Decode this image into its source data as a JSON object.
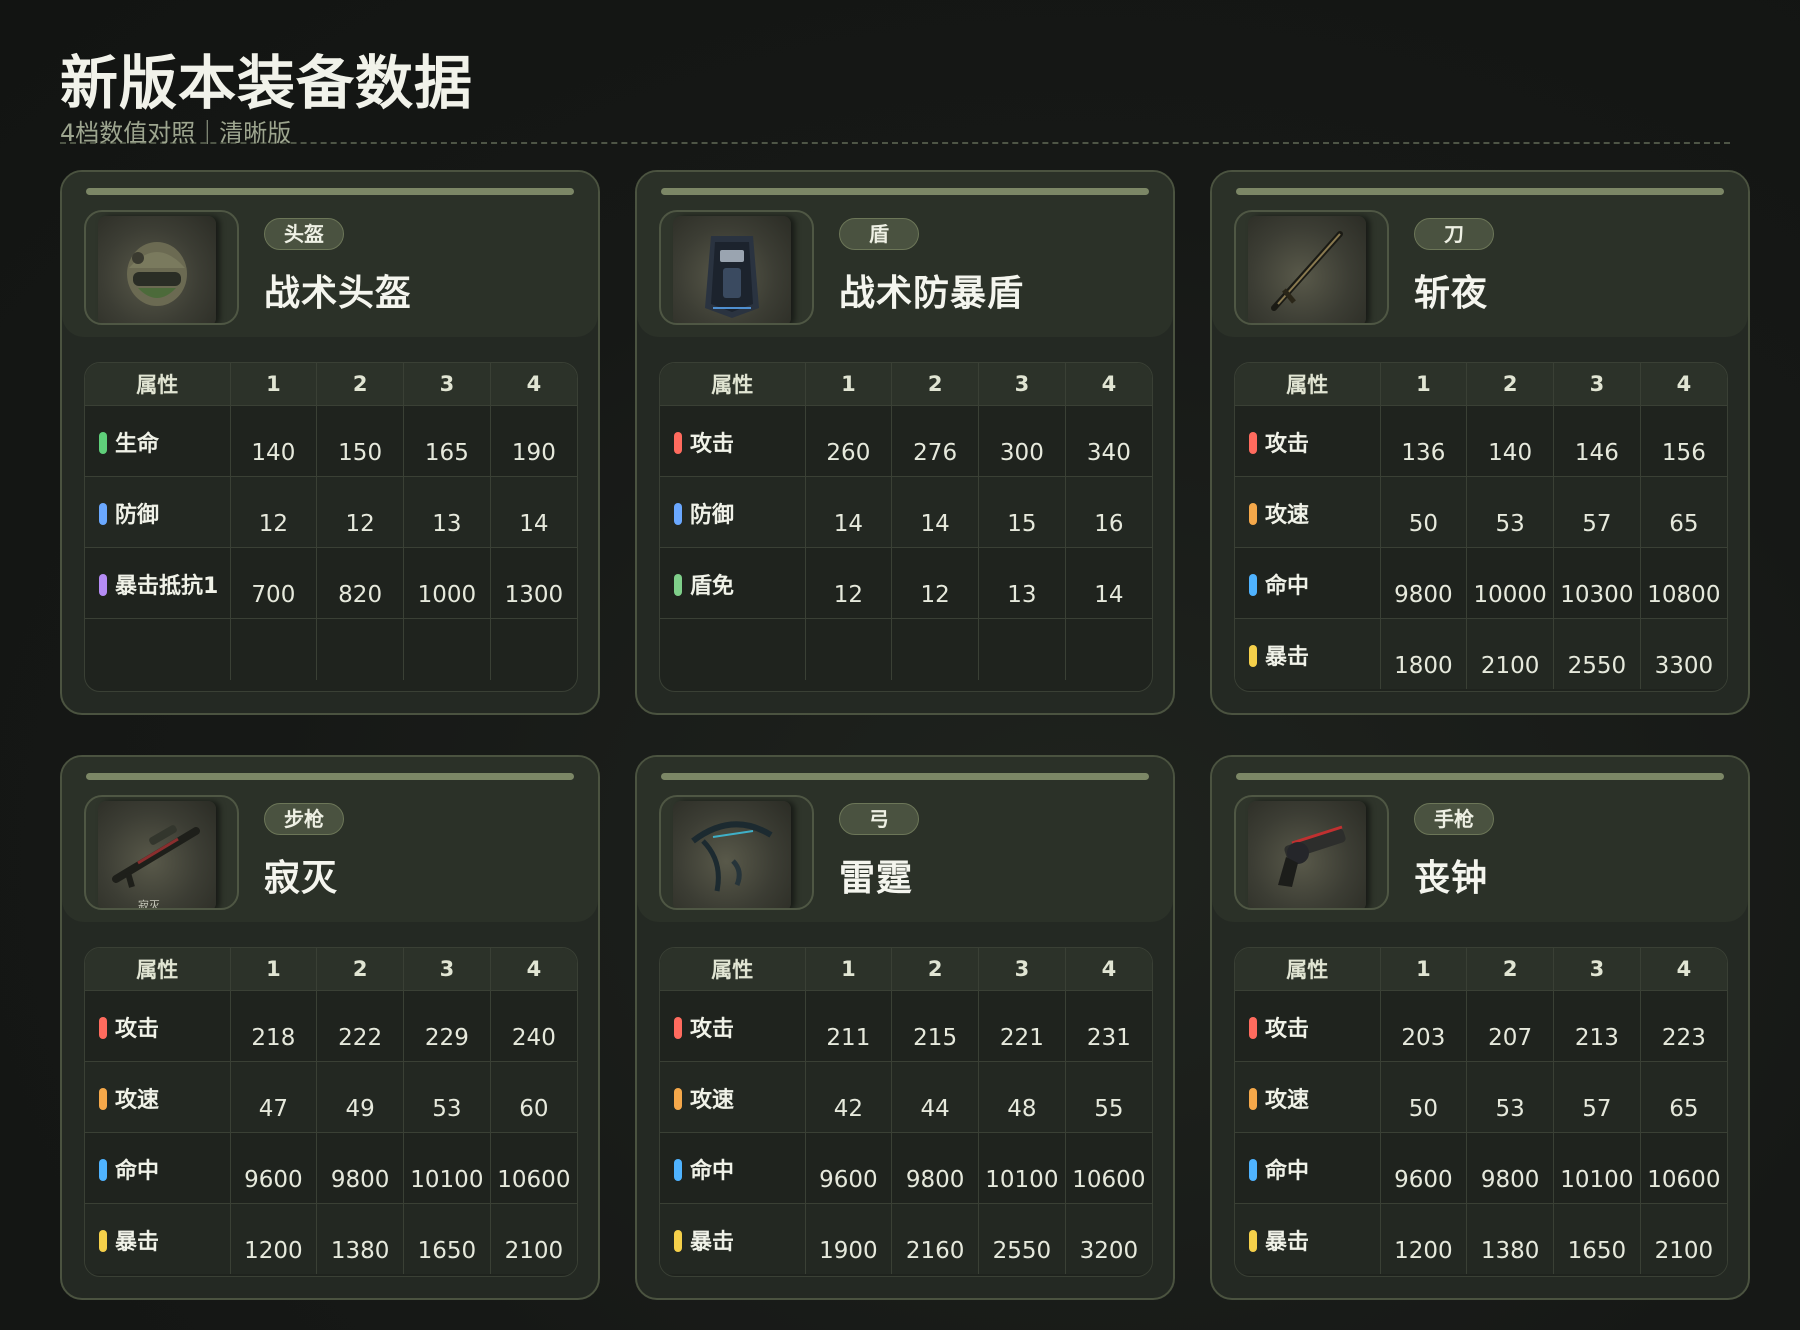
{
  "header": {
    "title": "新版本装备数据",
    "subtitle": "4档数值对照｜清晰版"
  },
  "table_headers": [
    "属性",
    "1",
    "2",
    "3",
    "4"
  ],
  "colors": {
    "hp": "#5fcf7a",
    "def": "#6aa8ff",
    "crit_res": "#b58cf5",
    "atk": "#ff6b5e",
    "spd": "#f5a84a",
    "hit": "#4fb3ff",
    "crit": "#f5d04a",
    "block": "#7fcf8a"
  },
  "cards": [
    {
      "tag": "头盔",
      "name": "战术头盔",
      "icon": "helmet-icon",
      "rows": [
        {
          "attr": "生命",
          "color": "#5fcf7a",
          "v": [
            "140",
            "150",
            "165",
            "190"
          ]
        },
        {
          "attr": "防御",
          "color": "#6aa8ff",
          "v": [
            "12",
            "12",
            "13",
            "14"
          ]
        },
        {
          "attr": "暴击抵抗1",
          "color": "#b58cf5",
          "v": [
            "700",
            "820",
            "1000",
            "1300"
          ]
        }
      ]
    },
    {
      "tag": "盾",
      "name": "战术防暴盾",
      "icon": "riot-shield-icon",
      "rows": [
        {
          "attr": "攻击",
          "color": "#ff6b5e",
          "v": [
            "260",
            "276",
            "300",
            "340"
          ]
        },
        {
          "attr": "防御",
          "color": "#6aa8ff",
          "v": [
            "14",
            "14",
            "15",
            "16"
          ]
        },
        {
          "attr": "盾免",
          "color": "#7fcf8a",
          "v": [
            "12",
            "12",
            "13",
            "14"
          ]
        }
      ]
    },
    {
      "tag": "刀",
      "name": "斩夜",
      "icon": "katana-icon",
      "rows": [
        {
          "attr": "攻击",
          "color": "#ff6b5e",
          "v": [
            "136",
            "140",
            "146",
            "156"
          ]
        },
        {
          "attr": "攻速",
          "color": "#f5a84a",
          "v": [
            "50",
            "53",
            "57",
            "65"
          ]
        },
        {
          "attr": "命中",
          "color": "#4fb3ff",
          "v": [
            "9800",
            "10000",
            "10300",
            "10800"
          ]
        },
        {
          "attr": "暴击",
          "color": "#f5d04a",
          "v": [
            "1800",
            "2100",
            "2550",
            "3300"
          ]
        }
      ]
    },
    {
      "tag": "步枪",
      "name": "寂灭",
      "icon": "rifle-icon",
      "thumb_caption": "寂灭",
      "rows": [
        {
          "attr": "攻击",
          "color": "#ff6b5e",
          "v": [
            "218",
            "222",
            "229",
            "240"
          ]
        },
        {
          "attr": "攻速",
          "color": "#f5a84a",
          "v": [
            "47",
            "49",
            "53",
            "60"
          ]
        },
        {
          "attr": "命中",
          "color": "#4fb3ff",
          "v": [
            "9600",
            "9800",
            "10100",
            "10600"
          ]
        },
        {
          "attr": "暴击",
          "color": "#f5d04a",
          "v": [
            "1200",
            "1380",
            "1650",
            "2100"
          ]
        }
      ]
    },
    {
      "tag": "弓",
      "name": "雷霆",
      "icon": "bow-icon",
      "rows": [
        {
          "attr": "攻击",
          "color": "#ff6b5e",
          "v": [
            "211",
            "215",
            "221",
            "231"
          ]
        },
        {
          "attr": "攻速",
          "color": "#f5a84a",
          "v": [
            "42",
            "44",
            "48",
            "55"
          ]
        },
        {
          "attr": "命中",
          "color": "#4fb3ff",
          "v": [
            "9600",
            "9800",
            "10100",
            "10600"
          ]
        },
        {
          "attr": "暴击",
          "color": "#f5d04a",
          "v": [
            "1900",
            "2160",
            "2550",
            "3200"
          ]
        }
      ]
    },
    {
      "tag": "手枪",
      "name": "丧钟",
      "icon": "revolver-icon",
      "rows": [
        {
          "attr": "攻击",
          "color": "#ff6b5e",
          "v": [
            "203",
            "207",
            "213",
            "223"
          ]
        },
        {
          "attr": "攻速",
          "color": "#f5a84a",
          "v": [
            "50",
            "53",
            "57",
            "65"
          ]
        },
        {
          "attr": "命中",
          "color": "#4fb3ff",
          "v": [
            "9600",
            "9800",
            "10100",
            "10600"
          ]
        },
        {
          "attr": "暴击",
          "color": "#f5d04a",
          "v": [
            "1200",
            "1380",
            "1650",
            "2100"
          ]
        }
      ]
    }
  ]
}
